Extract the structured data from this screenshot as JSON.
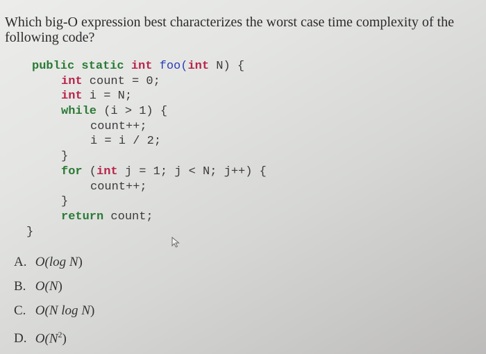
{
  "question": {
    "text": "Which big-O expression best characterizes the worst case time complexity of the following code?"
  },
  "code": {
    "lines": [
      {
        "tokens": [
          "public static",
          " ",
          "int",
          " ",
          "foo",
          "(",
          "int",
          " N) {"
        ]
      },
      {
        "text_kw": "int",
        "text_rest": " count = 0;"
      },
      {
        "text_kw": "int",
        "text_rest": " i = N;"
      },
      {
        "text_kw": "while",
        "text_rest": " (i > 1) {"
      },
      {
        "text": "count++;"
      },
      {
        "text": "i = i / 2;"
      },
      {
        "text": "}"
      },
      {
        "text_kw": "for",
        "text_mid": " (",
        "text_kw2": "int",
        "text_rest": " j = 1; j < N; j++) {"
      },
      {
        "text": "count++;"
      },
      {
        "text": "}"
      },
      {
        "text_kw": "return",
        "text_rest": " count;"
      },
      {
        "text": "}"
      }
    ]
  },
  "options": [
    {
      "letter": "A.",
      "prefix": "O(",
      "body": "log N",
      "suffix": ")"
    },
    {
      "letter": "B.",
      "prefix": "O(",
      "body": "N",
      "suffix": ")"
    },
    {
      "letter": "C.",
      "prefix": "O(",
      "body": "N log N",
      "suffix": ")"
    },
    {
      "letter": "D.",
      "prefix": "O(",
      "body": "N",
      "sup": "2",
      "suffix": ")"
    }
  ],
  "colors": {
    "keyword_green": "#2b7a35",
    "keyword_red": "#b8254a",
    "function_blue": "#2a3eb8"
  }
}
